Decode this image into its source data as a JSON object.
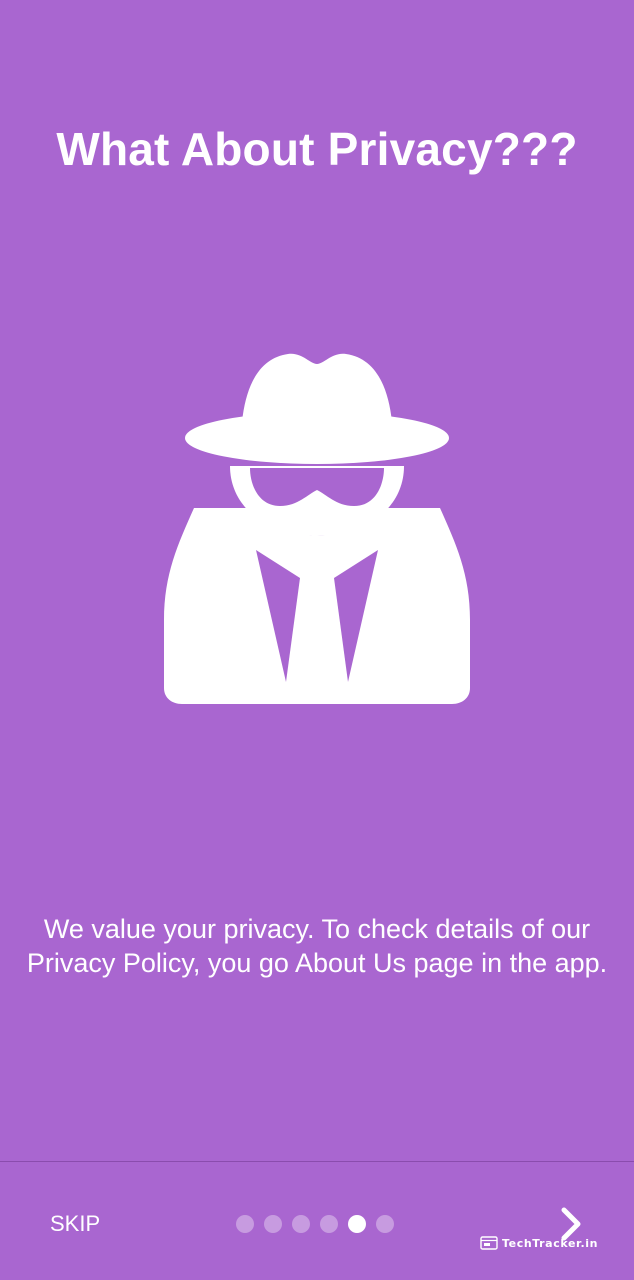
{
  "onboarding": {
    "title": "What About Privacy???",
    "illustration_icon": "incognito-spy-icon",
    "description": "We value your privacy. To check details of our Privacy Policy, you go About Us page in the app.",
    "page_count": 6,
    "current_page": 5
  },
  "bottom_bar": {
    "skip_label": "SKIP",
    "next_icon": "chevron-right-icon"
  },
  "watermark": {
    "text": "TechTracker.in",
    "icon": "browser-window-icon"
  },
  "colors": {
    "background": "#a966d0",
    "foreground": "#ffffff",
    "inactive_dot": "rgba(255,255,255,0.35)"
  }
}
